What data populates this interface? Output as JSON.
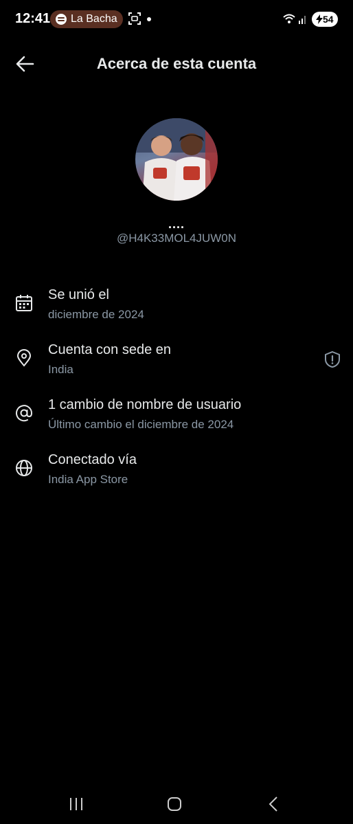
{
  "status_bar": {
    "time": "12:41",
    "media_app": "La Bacha",
    "battery": "54"
  },
  "header": {
    "title": "Acerca de esta cuenta"
  },
  "profile": {
    "display_name": "....",
    "username": "@H4K33MOL4JUW0N"
  },
  "info": [
    {
      "icon": "calendar-icon",
      "title": "Se unió el",
      "subtitle": "diciembre de 2024"
    },
    {
      "icon": "location-pin-icon",
      "title": "Cuenta con sede en",
      "subtitle": "India"
    },
    {
      "icon": "at-sign-icon",
      "title": "1 cambio de nombre de usuario",
      "subtitle": "Último cambio el diciembre de 2024"
    },
    {
      "icon": "globe-icon",
      "title": "Conectado vía",
      "subtitle": "India App Store"
    }
  ],
  "colors": {
    "background": "#000000",
    "primary_text": "#e7e9ea",
    "secondary_text": "#8b98a5",
    "media_pill": "#5a2f22"
  }
}
